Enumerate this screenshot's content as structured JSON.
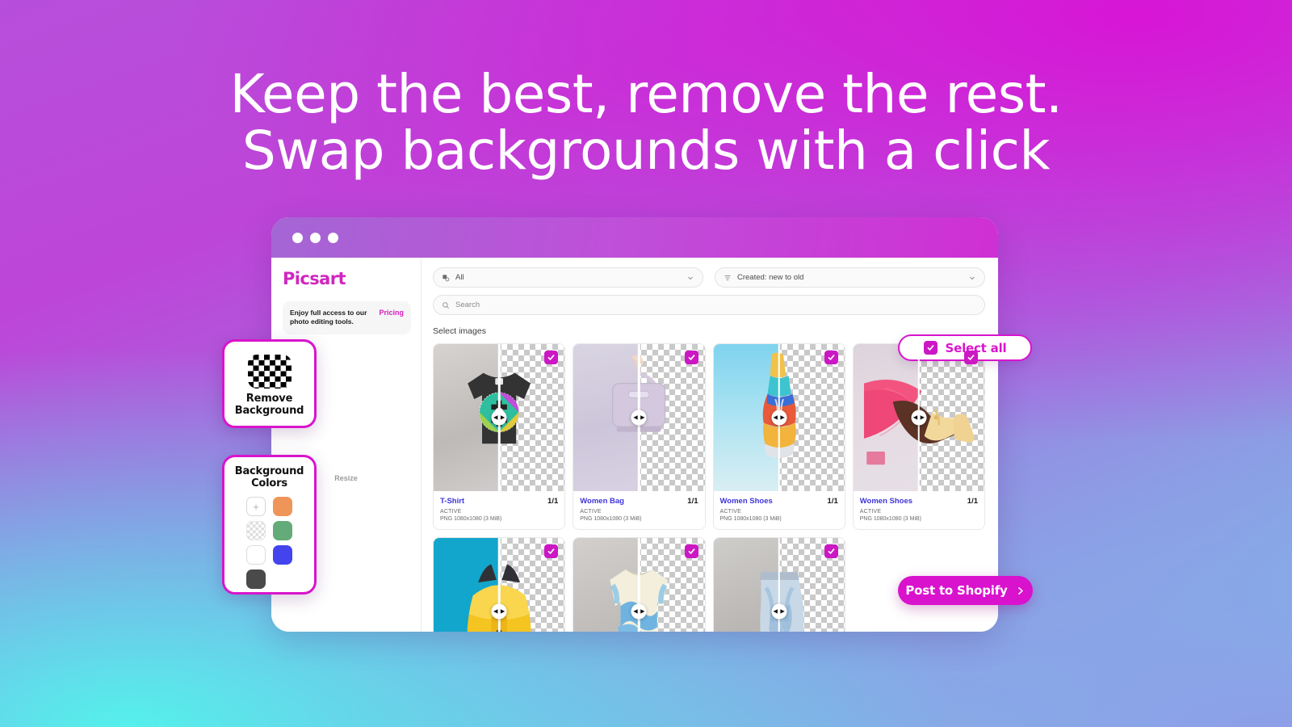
{
  "headline": {
    "line1": "Keep the best, remove the rest.",
    "line2": "Swap backgrounds with a click"
  },
  "colors": {
    "brand_magenta": "#d914cd",
    "logo_pink": "#cf27bf",
    "title_blue": "#3f34d8",
    "gradient_top": "#d716d6",
    "gradient_bottom_left": "#55f0ec",
    "gradient_bottom_right": "#8f9be8"
  },
  "browser": {
    "dots": [
      "dot-red",
      "dot-yellow",
      "dot-green"
    ]
  },
  "sidebar": {
    "logo": "Picsart",
    "promo_text": "Enjoy full access to our photo editing tools.",
    "promo_link": "Pricing",
    "resize_label": "Resize"
  },
  "toolbar": {
    "type_filter": {
      "value": "All",
      "icon": "layers-icon",
      "chevron": "chevron-down-icon"
    },
    "sort_filter": {
      "value": "Created: new to old",
      "icon": "sort-icon",
      "chevron": "chevron-down-icon"
    },
    "search": {
      "placeholder": "Search",
      "value": "",
      "icon": "search-icon"
    }
  },
  "gallery": {
    "label": "Select images",
    "select_all_label": "Select all",
    "select_all_checked": true,
    "post_button_label": "Post to Shopify",
    "post_button_arrow": "chevron-right-icon",
    "items": [
      {
        "title": "T-Shirt",
        "count": "1/1",
        "status": "ACTIVE",
        "file": "PNG 1080x1080 (3 MiB)",
        "selected": true,
        "art": "tshirt"
      },
      {
        "title": "Women Bag",
        "count": "1/1",
        "status": "ACTIVE",
        "file": "PNG 1080x1080 (3 MiB)",
        "selected": true,
        "art": "bag"
      },
      {
        "title": "Women Shoes",
        "count": "1/1",
        "status": "ACTIVE",
        "file": "PNG 1080x1080 (3 MiB)",
        "selected": true,
        "art": "sneaker"
      },
      {
        "title": "Women Shoes",
        "count": "1/1",
        "status": "ACTIVE",
        "file": "PNG 1080x1080 (3 MiB)",
        "selected": true,
        "art": "heel"
      },
      {
        "title": "",
        "count": "",
        "status": "",
        "file": "",
        "selected": true,
        "art": "backpack"
      },
      {
        "title": "",
        "count": "",
        "status": "",
        "file": "",
        "selected": true,
        "art": "sweater"
      },
      {
        "title": "",
        "count": "",
        "status": "",
        "file": "",
        "selected": true,
        "art": "jeans"
      }
    ]
  },
  "tool_cards": {
    "remove_background": {
      "title_line1": "Remove",
      "title_line2": "Background",
      "icon": "checkerboard-icon"
    },
    "background_colors": {
      "title_line1": "Background",
      "title_line2": "Colors",
      "swatches": [
        {
          "name": "add-color",
          "type": "add",
          "hex": ""
        },
        {
          "name": "orange",
          "type": "solid",
          "hex": "#f0955a"
        },
        {
          "name": "transparent",
          "type": "transparent",
          "hex": ""
        },
        {
          "name": "green",
          "type": "solid",
          "hex": "#63ab78"
        },
        {
          "name": "white",
          "type": "white",
          "hex": "#ffffff"
        },
        {
          "name": "blue",
          "type": "solid",
          "hex": "#4444ee"
        },
        {
          "name": "dark-gray",
          "type": "solid",
          "hex": "#4a4a4a"
        }
      ]
    }
  }
}
